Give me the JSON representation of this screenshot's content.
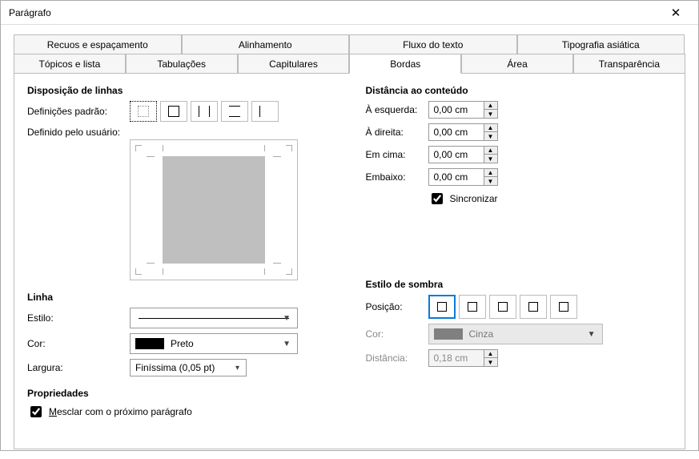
{
  "window": {
    "title": "Parágrafo"
  },
  "tabs": {
    "row1": [
      "Recuos e espaçamento",
      "Alinhamento",
      "Fluxo do texto",
      "Tipografia asiática"
    ],
    "row2": [
      "Tópicos e lista",
      "Tabulações",
      "Capitulares",
      "Bordas",
      "Área",
      "Transparência"
    ],
    "active": "Bordas"
  },
  "sections": {
    "line_arrangement": "Disposição de linhas",
    "defaults_label": "Definições padrão:",
    "user_defined": "Definido pelo usuário:",
    "line": "Linha",
    "style": "Estilo:",
    "color": "Cor:",
    "width_label": "Largura:",
    "props": "Propriedades",
    "merge_label": "Mesclar com o próximo parágrafo",
    "padding": "Distância ao conteúdo",
    "left": "À esquerda:",
    "right": "À direita:",
    "top": "Em cima:",
    "bottom": "Embaixo:",
    "sync": "Sincronizar",
    "shadow": "Estilo de sombra",
    "position": "Posição:",
    "shadow_color": "Cor:",
    "distance": "Distância:"
  },
  "values": {
    "pad_left": "0,00 cm",
    "pad_right": "0,00 cm",
    "pad_top": "0,00 cm",
    "pad_bottom": "0,00 cm",
    "sync_checked": true,
    "line_color": "Preto",
    "line_width": "Finíssima (0,05 pt)",
    "shadow_color": "Cinza",
    "shadow_distance": "0,18 cm",
    "merge_checked": true
  }
}
